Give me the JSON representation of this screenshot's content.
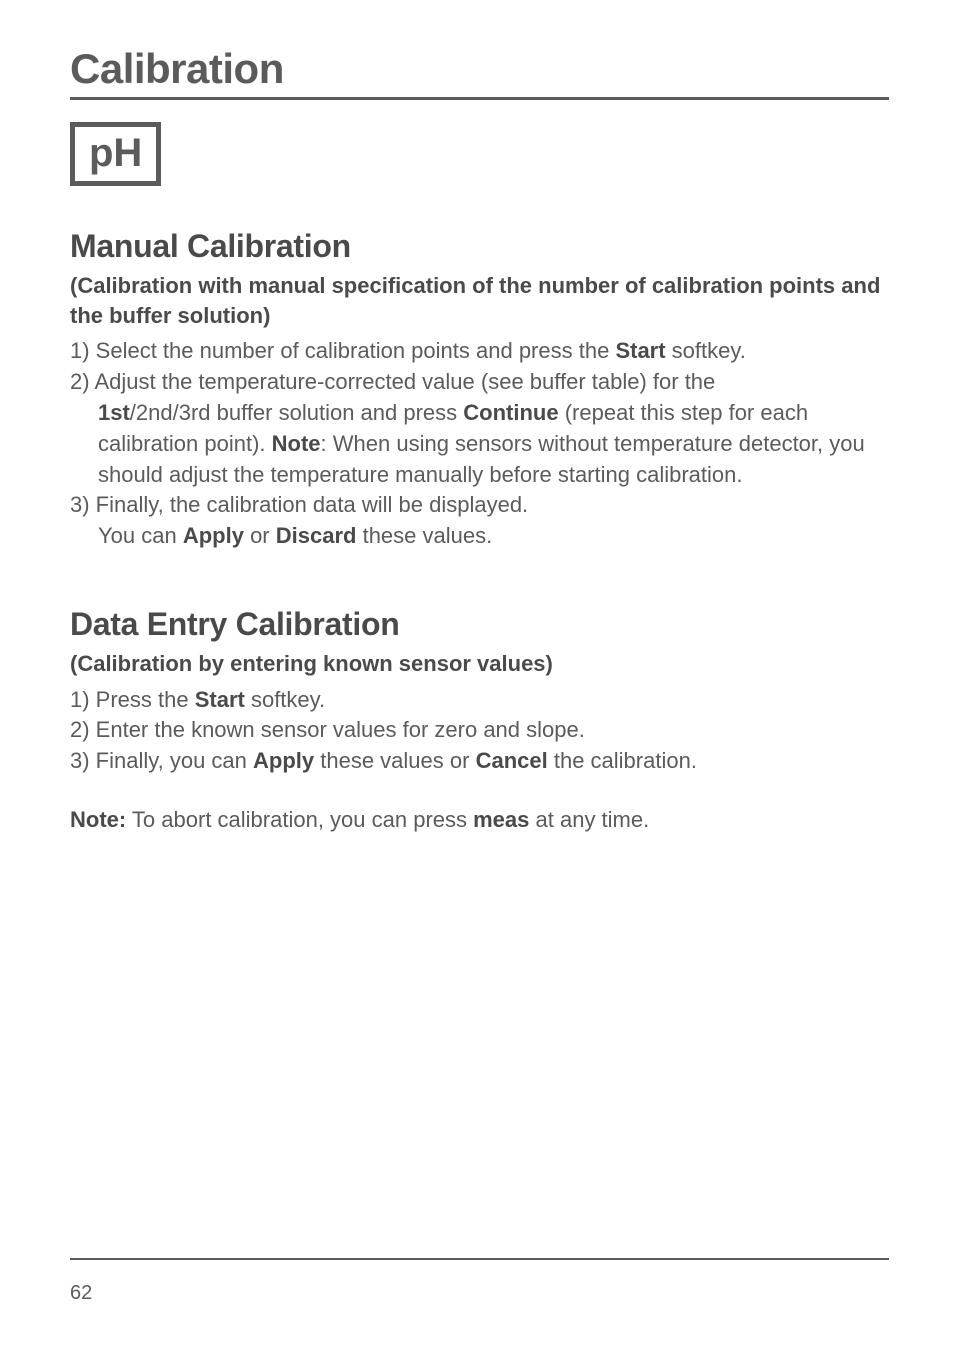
{
  "title": "Calibration",
  "ph_label": "pH",
  "section1": {
    "heading": "Manual Calibration",
    "sub": "(Calibration with manual specification of the number of calibration points and the buffer solution)",
    "line1_a": "1) Select the number of calibration points and press the ",
    "line1_b": "Start",
    "line1_c": " softkey.",
    "line2": "2) Adjust the temperature-corrected value (see buffer table) for the",
    "line2b_a": "1st",
    "line2b_b": "/2nd/3rd buffer solution and press ",
    "line2b_c": "Continue",
    "line2b_d": " (repeat this step for each calibration point). ",
    "line2b_e": "Note",
    "line2b_f": ": When using sensors without temperature detector, you should adjust the temperature manually before starting calibration.",
    "line3": "3) Finally, the calibration data will be displayed.",
    "line3b_a": "You can ",
    "line3b_b": "Apply",
    "line3b_c": " or ",
    "line3b_d": "Discard",
    "line3b_e": " these values."
  },
  "section2": {
    "heading": "Data Entry Calibration",
    "sub": "(Calibration by entering known sensor values)",
    "line1_a": "1) Press the ",
    "line1_b": "Start",
    "line1_c": " softkey.",
    "line2": "2) Enter the known sensor values for zero and slope.",
    "line3_a": "3) Finally, you can ",
    "line3_b": "Apply",
    "line3_c": " these values or ",
    "line3_d": "Cancel",
    "line3_e": " the calibration."
  },
  "note": {
    "a": "Note:",
    "b": " To abort calibration, you can press ",
    "c": "meas",
    "d": " at any time."
  },
  "page": "62"
}
